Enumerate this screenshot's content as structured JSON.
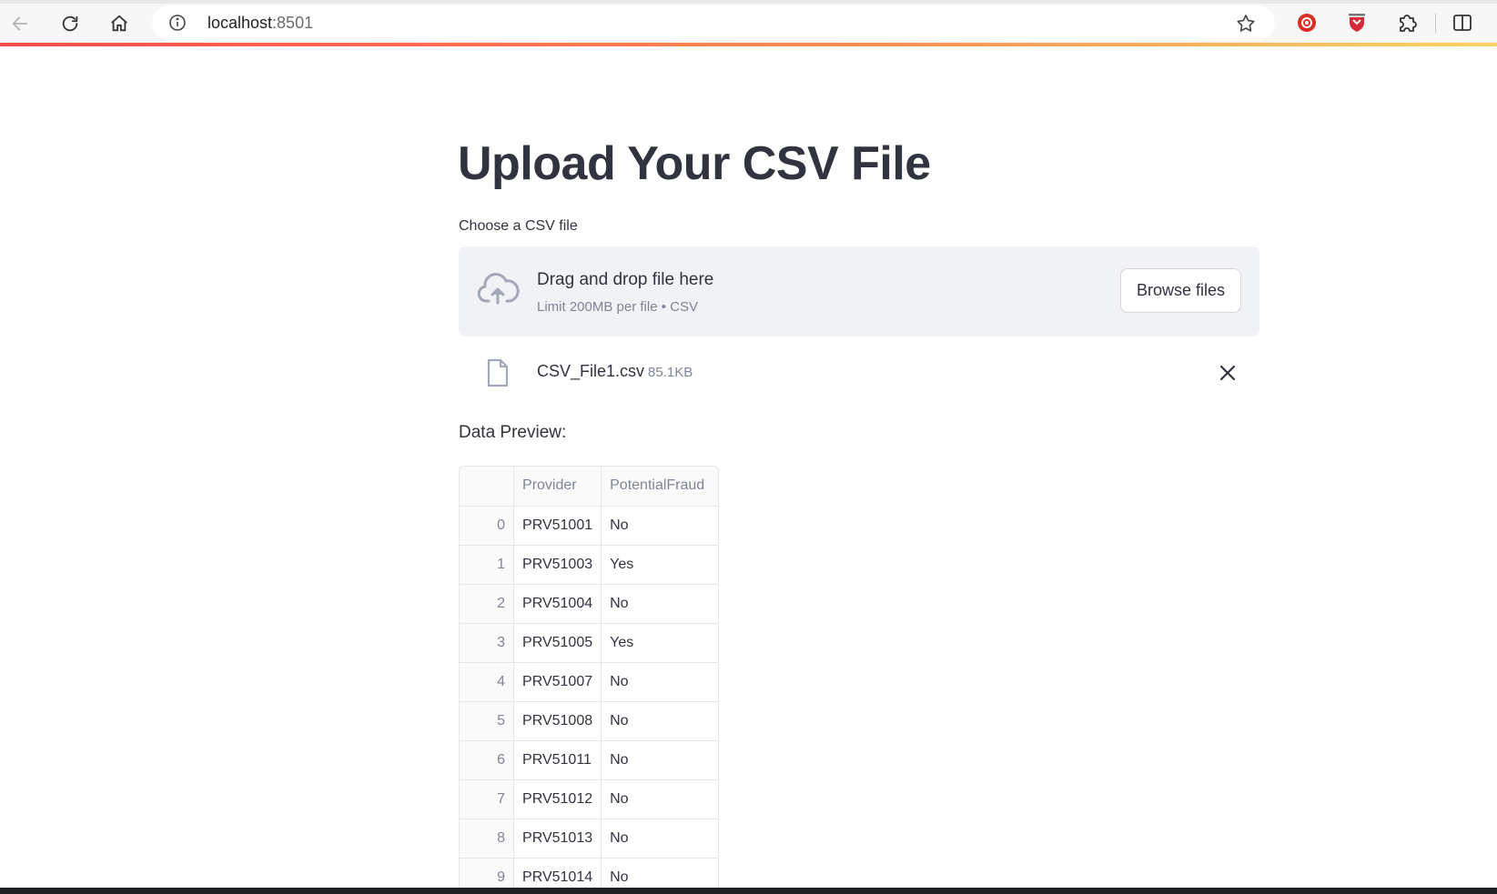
{
  "browser": {
    "url_host": "localhost",
    "url_port": ":8501"
  },
  "page": {
    "title": "Upload Your CSV File",
    "uploader_label": "Choose a CSV file",
    "dropzone": {
      "title": "Drag and drop file here",
      "subtitle": "Limit 200MB per file • CSV",
      "browse_label": "Browse files"
    },
    "uploaded_file": {
      "name": "CSV_File1.csv",
      "size": "85.1KB"
    },
    "preview_label": "Data Preview:"
  },
  "table": {
    "columns": [
      "",
      "Provider",
      "PotentialFraud"
    ],
    "rows": [
      {
        "idx": "0",
        "provider": "PRV51001",
        "fraud": "No"
      },
      {
        "idx": "1",
        "provider": "PRV51003",
        "fraud": "Yes"
      },
      {
        "idx": "2",
        "provider": "PRV51004",
        "fraud": "No"
      },
      {
        "idx": "3",
        "provider": "PRV51005",
        "fraud": "Yes"
      },
      {
        "idx": "4",
        "provider": "PRV51007",
        "fraud": "No"
      },
      {
        "idx": "5",
        "provider": "PRV51008",
        "fraud": "No"
      },
      {
        "idx": "6",
        "provider": "PRV51011",
        "fraud": "No"
      },
      {
        "idx": "7",
        "provider": "PRV51012",
        "fraud": "No"
      },
      {
        "idx": "8",
        "provider": "PRV51013",
        "fraud": "No"
      },
      {
        "idx": "9",
        "provider": "PRV51014",
        "fraud": "No"
      }
    ]
  },
  "colors": {
    "accent": "#ff4b4b",
    "text": "#31333f",
    "muted": "#808495",
    "dropzone_bg": "#f0f2f6"
  },
  "icons": {
    "back": "arrow-left-icon",
    "reload": "reload-icon",
    "home": "home-icon",
    "info": "info-icon",
    "star": "star-icon",
    "ext1": "record-extension-icon",
    "ext2": "shield-extension-icon",
    "extensions": "puzzle-icon",
    "split": "split-screen-icon",
    "upload": "cloud-upload-icon",
    "file": "file-icon",
    "remove": "close-icon"
  }
}
